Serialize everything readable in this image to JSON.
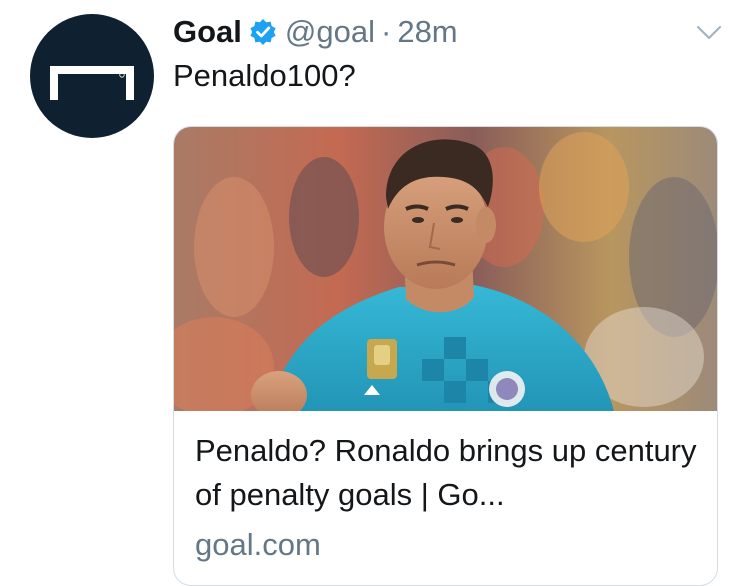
{
  "tweet": {
    "author_name": "Goal",
    "handle": "@goal",
    "separator": "·",
    "timestamp": "28m",
    "text": "Penaldo100?",
    "verified_icon": "verified-badge-icon",
    "menu_icon": "chevron-down-icon"
  },
  "card": {
    "title": "Penaldo? Ronaldo brings up century of penalty goals | Go...",
    "domain": "goal.com",
    "image_description_icon": "footballer-photo"
  },
  "colors": {
    "avatar_bg": "#0f2130",
    "verified": "#1da1f2",
    "secondary_text": "#657786",
    "jersey": "#2aa9c9"
  }
}
